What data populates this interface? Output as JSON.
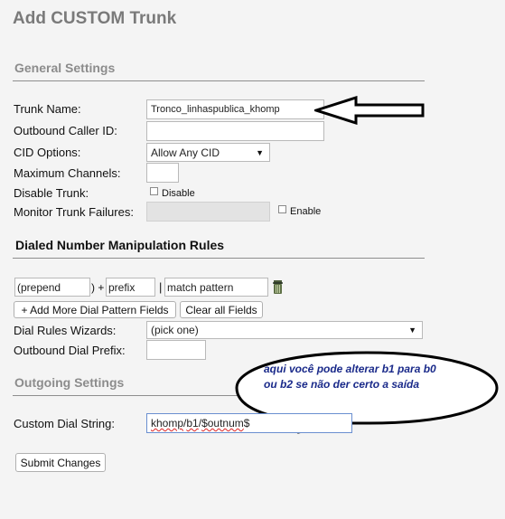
{
  "page": {
    "title": "Add CUSTOM Trunk"
  },
  "general": {
    "heading": "General Settings",
    "trunk_name": {
      "label": "Trunk Name:",
      "value": "Tronco_linhaspublica_khomp"
    },
    "outbound_cid": {
      "label": "Outbound Caller ID:",
      "value": ""
    },
    "cid_options": {
      "label": "CID Options:",
      "value": "Allow Any CID"
    },
    "max_channels": {
      "label": "Maximum Channels:",
      "value": ""
    },
    "disable_trunk": {
      "label": "Disable Trunk:",
      "checkbox_label": "Disable"
    },
    "monitor": {
      "label": "Monitor Trunk Failures:",
      "checkbox_label": "Enable",
      "value": ""
    }
  },
  "dialed": {
    "heading": "Dialed Number Manipulation Rules",
    "prepend_open": "(",
    "prepend_placeholder": "prepend",
    "prepend_close": ") +",
    "prefix_placeholder": "prefix",
    "pipe": "|",
    "match_placeholder": "match pattern",
    "add_more_label": "+ Add More Dial Pattern Fields",
    "clear_all_label": "Clear all Fields",
    "wizards": {
      "label": "Dial Rules Wizards:",
      "value": "(pick one)"
    },
    "outbound_prefix": {
      "label": "Outbound Dial Prefix:",
      "value": ""
    }
  },
  "outgoing": {
    "heading": "Outgoing Settings",
    "custom_dial": {
      "label": "Custom Dial String:",
      "value_parts": [
        "khomp",
        "/",
        "b1",
        "/",
        "$outnum",
        "$"
      ]
    }
  },
  "submit_label": "Submit Changes",
  "annotation": {
    "line1": "aqui você pode alterar b1 para b0",
    "line2": "ou b2 se não der certo a saída"
  }
}
